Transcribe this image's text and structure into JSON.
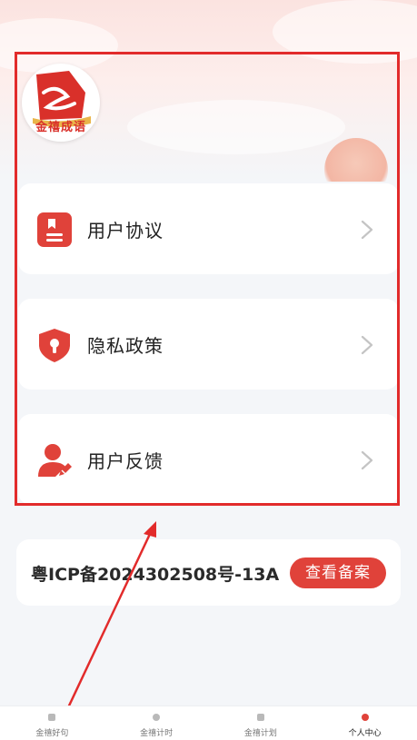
{
  "profile": {
    "avatar_text": "金禧成语"
  },
  "menu": [
    {
      "label": "用户协议",
      "icon": "document-icon"
    },
    {
      "label": "隐私政策",
      "icon": "shield-lock-icon"
    },
    {
      "label": "用户反馈",
      "icon": "user-edit-icon"
    }
  ],
  "icp": {
    "text": "粤ICP备2024302508号-13A",
    "button_label": "查看备案"
  },
  "tabbar": [
    {
      "label": "金禧好句",
      "active": false
    },
    {
      "label": "金禧计时",
      "active": false
    },
    {
      "label": "金禧计划",
      "active": false
    },
    {
      "label": "个人中心",
      "active": true
    }
  ],
  "colors": {
    "accent": "#e0423a",
    "highlight": "#e22b2b"
  }
}
